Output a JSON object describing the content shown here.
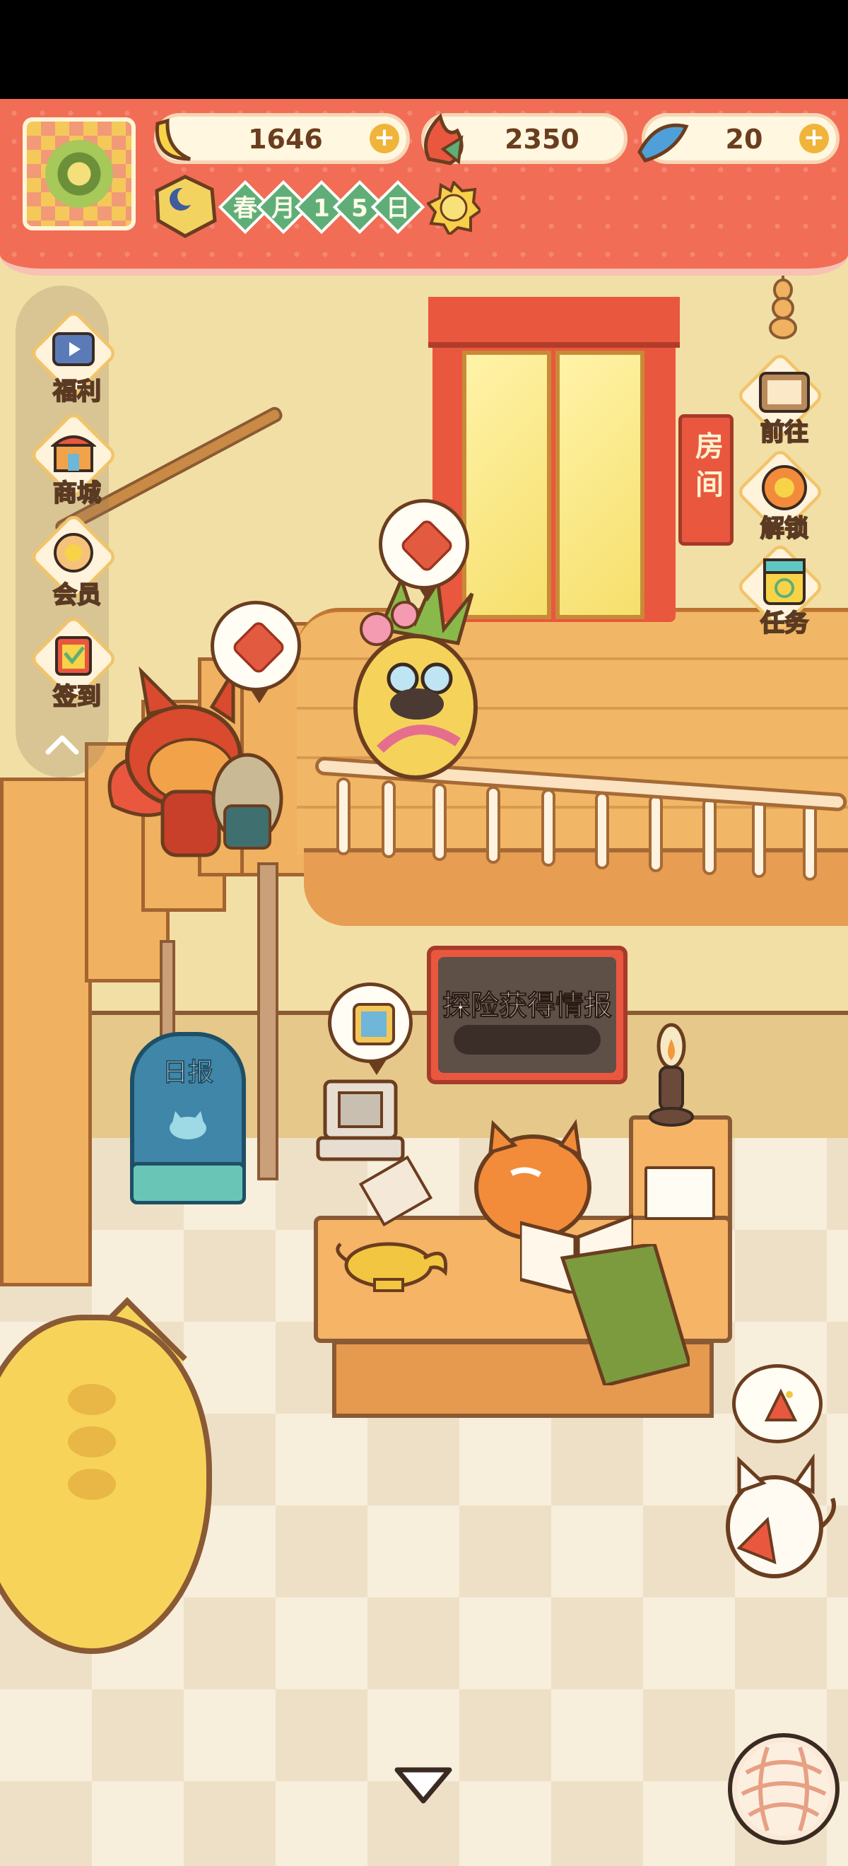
{
  "hud": {
    "currencies": [
      {
        "name": "banana",
        "value": "1646",
        "has_plus": true
      },
      {
        "name": "fire-fish",
        "value": "2350",
        "has_plus": false
      },
      {
        "name": "blue-fish",
        "value": "20",
        "has_plus": true
      }
    ],
    "date": {
      "chars": [
        "春",
        "月",
        "1",
        "5",
        "日"
      ],
      "weather": "sunny-icon"
    },
    "plus_symbol": "+"
  },
  "left_menu": [
    {
      "label": "福利",
      "icon": "tv-icon"
    },
    {
      "label": "商城",
      "icon": "shop-icon"
    },
    {
      "label": "会员",
      "icon": "flower-badge-icon"
    },
    {
      "label": "签到",
      "icon": "calendar-sign-icon"
    }
  ],
  "right_menu": [
    {
      "label": "前往",
      "icon": "signboard-icon"
    },
    {
      "label": "解锁",
      "icon": "unlock-icon"
    },
    {
      "label": "任务",
      "icon": "task-clipboard-icon"
    }
  ],
  "scene": {
    "door_sign": [
      "房",
      "间"
    ],
    "intel_board_title": "探险获得情报",
    "newsboard_label": "日报"
  },
  "colors": {
    "banner": "#f26d55",
    "wall": "#f2dfa6",
    "floor": "#f7eedc",
    "wood": "#f1b766",
    "accent_green": "#5fae78",
    "outline": "#6b3d1f"
  }
}
